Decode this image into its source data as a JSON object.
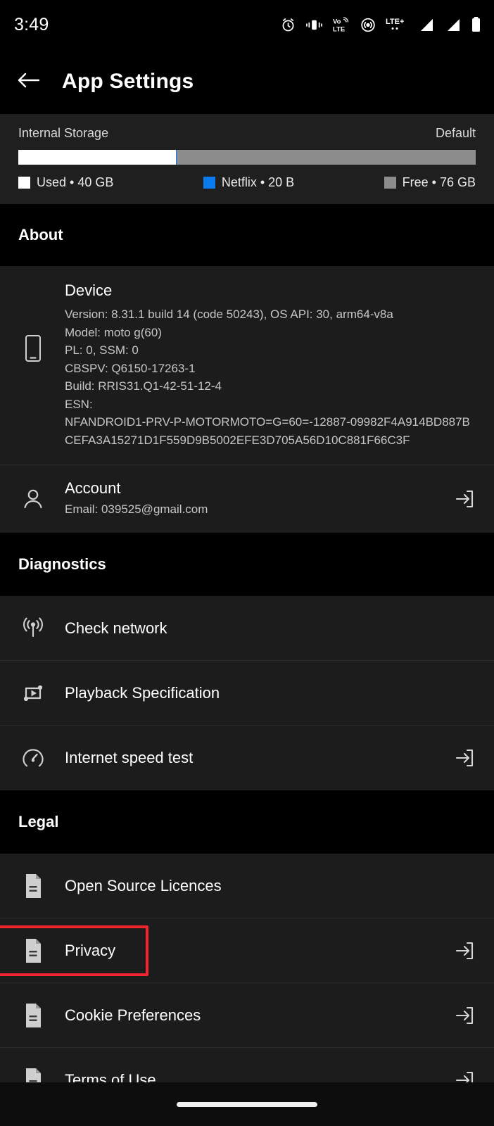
{
  "status_bar": {
    "time": "3:49",
    "icons": [
      {
        "name": "alarm-icon",
        "label": "alarm"
      },
      {
        "name": "vibrate-icon",
        "label": "vibrate"
      },
      {
        "name": "volte-icon",
        "label": "VoLTE"
      },
      {
        "name": "hotspot-icon",
        "label": "hotspot"
      },
      {
        "name": "lte-plus-icon",
        "label": "LTE+"
      },
      {
        "name": "signal-bars-1-icon",
        "label": "signal 1"
      },
      {
        "name": "signal-bars-2-icon",
        "label": "signal 2"
      },
      {
        "name": "battery-icon",
        "label": "battery"
      }
    ],
    "volte_top": "Vo",
    "volte_bottom": "LTE",
    "lte_text": "LTE+"
  },
  "app_bar": {
    "back_icon": "back-arrow-icon",
    "title": "App Settings"
  },
  "storage": {
    "label": "Internal Storage",
    "default_label": "Default",
    "bar": {
      "used_pct": 34.5,
      "netflix_pct": 0.15,
      "free_pct": 65.35
    },
    "colors": {
      "used": "#ffffff",
      "netflix": "#0a7cf0",
      "free": "#8d8d8d"
    },
    "legend": [
      {
        "label": "Used • 40 GB",
        "color": "#ffffff",
        "name": "legend-used"
      },
      {
        "label": "Netflix • 20 B",
        "color": "#0a7cf0",
        "name": "legend-netflix"
      },
      {
        "label": "Free • 76 GB",
        "color": "#8d8d8d",
        "name": "legend-free"
      }
    ]
  },
  "sections": {
    "about": {
      "heading": "About",
      "device": {
        "icon": "smartphone-icon",
        "title": "Device",
        "lines": [
          "Version: 8.31.1 build 14 (code 50243), OS API: 30, arm64-v8a",
          "Model: moto g(60)",
          "PL: 0, SSM: 0",
          "CBSPV: Q6150-17263-1",
          "Build: RRIS31.Q1-42-51-12-4",
          "ESN:",
          "NFANDROID1-PRV-P-MOTORMOTO=G=60=-12887-09982F4A914BD887BCEFA3A15271D1F559D9B5002EFE3D705A56D10C881F66C3F"
        ]
      },
      "account": {
        "icon": "person-icon",
        "title": "Account",
        "subtitle": "Email: 039525@gmail.com",
        "action_icon": "open-in-icon"
      }
    },
    "diagnostics": {
      "heading": "Diagnostics",
      "items": [
        {
          "icon": "broadcast-signal-icon",
          "label": "Check network",
          "action": false
        },
        {
          "icon": "playback-spec-icon",
          "label": "Playback Specification",
          "action": false
        },
        {
          "icon": "speedometer-icon",
          "label": "Internet speed test",
          "action": true
        }
      ]
    },
    "legal": {
      "heading": "Legal",
      "items": [
        {
          "icon": "document-icon",
          "label": "Open Source Licences",
          "action": false,
          "highlighted": false
        },
        {
          "icon": "document-icon",
          "label": "Privacy",
          "action": true,
          "highlighted": true
        },
        {
          "icon": "document-icon",
          "label": "Cookie Preferences",
          "action": true,
          "highlighted": false
        },
        {
          "icon": "document-icon",
          "label": "Terms of Use",
          "action": true,
          "highlighted": false
        }
      ]
    }
  },
  "highlight": {
    "color": "#f22430",
    "target": "Privacy"
  },
  "nav_bar": {
    "home_indicator": "home-indicator"
  }
}
